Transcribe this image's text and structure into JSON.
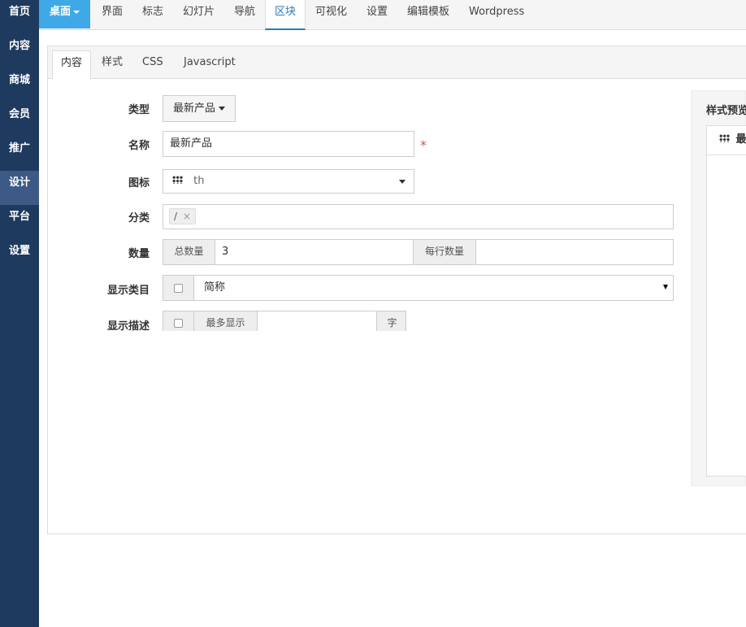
{
  "sidebar": {
    "items": [
      {
        "label": "首页"
      },
      {
        "label": "内容"
      },
      {
        "label": "商城"
      },
      {
        "label": "会员"
      },
      {
        "label": "推广"
      },
      {
        "label": "设计"
      },
      {
        "label": "平台"
      },
      {
        "label": "设置"
      }
    ],
    "active": "设计"
  },
  "topnav": {
    "desk_label": "桌面",
    "items": [
      "界面",
      "标志",
      "幻灯片",
      "导航",
      "区块",
      "可视化",
      "设置",
      "编辑模板",
      "Wordpress"
    ],
    "active": "区块"
  },
  "tabs": [
    "内容",
    "样式",
    "CSS",
    "Javascript"
  ],
  "form": {
    "type_label": "类型",
    "type_value": "最新产品",
    "name_label": "名称",
    "name_value": "最新产品",
    "icon_label": "图标",
    "icon_value": "th",
    "category_label": "分类",
    "category_tag": "/",
    "category_tag_remove": "×",
    "quantity_label": "数量",
    "total_label": "总数量",
    "total_value": "3",
    "per_row_label": "每行数量",
    "per_row_value": "",
    "show_category_label": "显示类目",
    "show_category_select": "简称",
    "show_desc_label": "显示描述",
    "max_show_label": "最多显示",
    "max_show_value": "",
    "unit_char": "字"
  },
  "preview": {
    "title": "样式预览",
    "header": "最新"
  },
  "colors": {
    "sidebar_bg": "#1e3a5f",
    "accent": "#3fa9e8",
    "required": "#d9534f"
  }
}
